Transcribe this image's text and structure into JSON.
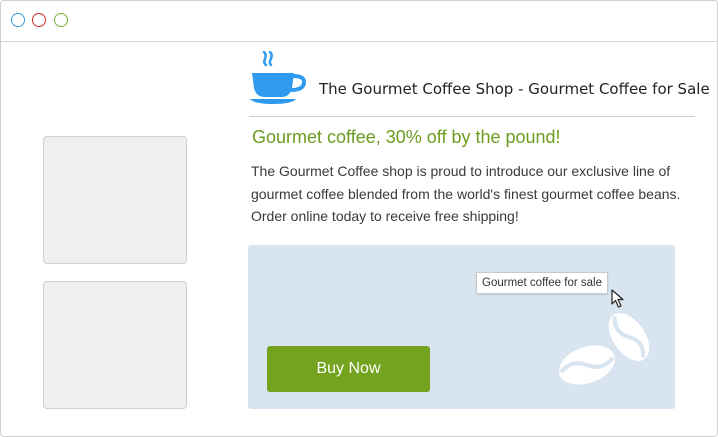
{
  "site": {
    "header_title": "The Gourmet Coffee Shop - Gourmet Coffee for Sale"
  },
  "icons": {
    "cup": "coffee-cup-icon",
    "beans": "coffee-beans-icon",
    "cursor": "mouse-cursor-icon"
  },
  "article": {
    "headline": "Gourmet coffee, 30% off by the pound!",
    "body": "The Gourmet Coffee shop is proud to introduce our exclusive line of gourmet coffee blended from the world's finest gourmet coffee beans. Order online today to receive free shipping!"
  },
  "promo": {
    "tooltip": "Gourmet coffee for sale",
    "button_label": "Buy Now"
  },
  "colors": {
    "accent_green": "#74a31f",
    "headline_green": "#6b9c1f",
    "icon_blue": "#2f9bf0",
    "promo_bg": "#d8e4ef"
  }
}
